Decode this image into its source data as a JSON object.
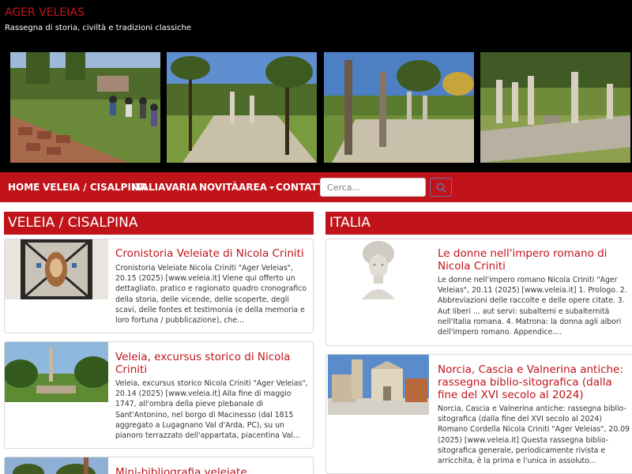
{
  "site": {
    "title": "AGER VELEIAS",
    "tagline": "Rassegna di storia, civiltà e tradizioni classiche"
  },
  "nav": {
    "items": [
      "HOME",
      "VELEIA / CISALPINA",
      "ITALIA",
      "VARIA",
      "NOVITÀ",
      "AREA",
      "CONTATTI"
    ],
    "search_placeholder": "Cerca..."
  },
  "sections": {
    "left": {
      "title": "VELEIA / CISALPINA",
      "articles": [
        {
          "title": "Cronistoria Veleiate di Nicola Criniti",
          "excerpt": "Cronistoria Veleiate Nicola Criniti \"Ager Veleias\", 20.15 (2025) [www.veleia.it] Viene qui offerto un dettagliato, pratico e ragionato quadro cronografico della storia, delle vicende, delle scoperte, degli scavi, delle fontes et testimonia (e della memoria e loro fortuna / pubblicazione), che..."
        },
        {
          "title": "Veleia, excursus storico di Nicola Criniti",
          "excerpt": "Veleia, excursus storico Nicola Criniti \"Ager Veleias\", 20.14 (2025) [www.veleia.it] Alla fine di maggio 1747, all'ombra della pieve plebanale di Sant'Antonino, nel borgo di Macinesso (dal 1815 aggregato a Lugagnano Val d'Arda, PC), su un pianoro terrazzato dell'appartata, piacentina Val..."
        },
        {
          "title": "Mini-bibliografia veleiate",
          "excerpt": ""
        }
      ]
    },
    "right": {
      "title": "ITALIA",
      "articles": [
        {
          "title": "Le donne nell'impero romano di Nicola Criniti",
          "excerpt": "Le donne nell'impero romano Nicola Criniti \"Ager Veleias\", 20.11 (2025) [www.veleia.it] 1. Prologo. 2. Abbreviazioni delle raccolte e delle opere citate. 3. Aut liberi ... aut servi: subalterni e subalternità nell'Italia romana. 4. Matrona: la donna agli albori dell'impero romano. Appendice...."
        },
        {
          "title": "Norcia, Cascia e Valnerina antiche: rassegna biblio-sitografica (dalla fine del XVI secolo al 2024)",
          "excerpt": "Norcia, Cascia e Valnerina antiche: rassegna biblio-sitografica (dalla fine del XVI secolo al 2024) Romano Cordella Nicola Criniti \"Ager Veleias\", 20.09 (2025) [www.veleia.it] Questa rassegna biblio-sitografica generale, periodicamente rivista e arricchita, è la prima e l'unica in assoluto..."
        }
      ]
    }
  },
  "colors": {
    "brand": "#c0141a",
    "header_bg": "#000000",
    "text": "#333333"
  },
  "icons": {
    "search": "search-icon"
  }
}
